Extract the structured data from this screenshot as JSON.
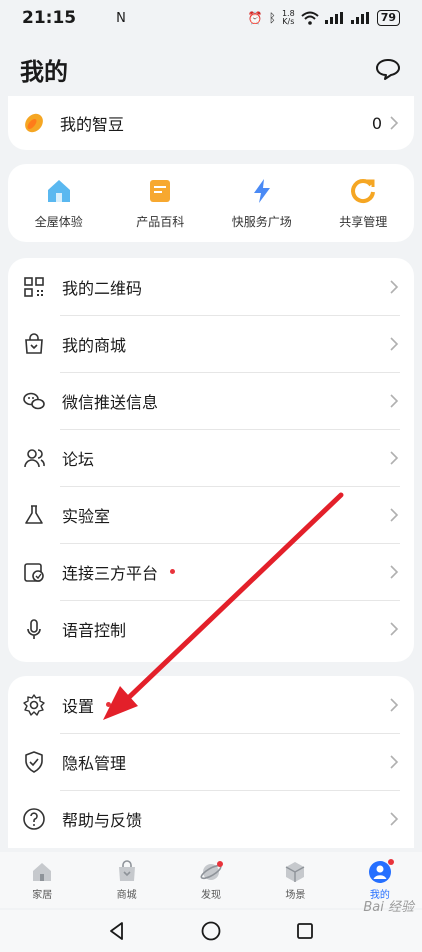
{
  "status": {
    "time": "21:15",
    "nfc": "N",
    "speed_value": "1.8",
    "speed_unit": "K/s",
    "battery": "79"
  },
  "header": {
    "title": "我的"
  },
  "bean": {
    "label": "我的智豆",
    "count": "0"
  },
  "quick": [
    {
      "label": "全屋体验"
    },
    {
      "label": "产品百科"
    },
    {
      "label": "快服务广场"
    },
    {
      "label": "共享管理"
    }
  ],
  "menu": [
    {
      "label": "我的二维码"
    },
    {
      "label": "我的商城"
    },
    {
      "label": "微信推送信息"
    },
    {
      "label": "论坛"
    },
    {
      "label": "实验室"
    },
    {
      "label": "连接三方平台"
    },
    {
      "label": "语音控制"
    }
  ],
  "settings_menu": [
    {
      "label": "设置"
    },
    {
      "label": "隐私管理"
    },
    {
      "label": "帮助与反馈"
    }
  ],
  "tabs": [
    {
      "label": "家居"
    },
    {
      "label": "商城"
    },
    {
      "label": "发现"
    },
    {
      "label": "场景"
    },
    {
      "label": "我的"
    }
  ],
  "watermark": "Bai 经验",
  "colors": {
    "accent": "#256fff",
    "dot": "#e8333b",
    "arrow": "#e3202a"
  }
}
